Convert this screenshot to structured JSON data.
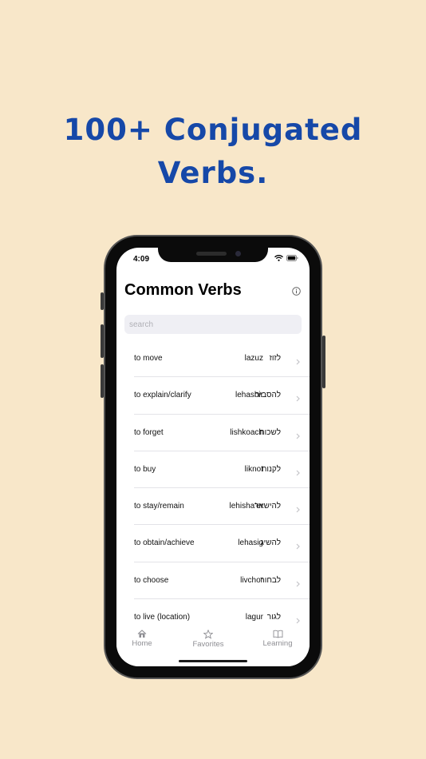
{
  "headline": {
    "line1": "100+ Conjugated",
    "line2": "Verbs."
  },
  "status": {
    "time": "4:09"
  },
  "nav": {
    "title": "Common Verbs"
  },
  "search": {
    "placeholder": "search"
  },
  "verbs": [
    {
      "english": "to move",
      "transliteration": "lazuz",
      "hebrew": "לזוז"
    },
    {
      "english": "to explain/clarify",
      "transliteration": "lehasbir",
      "hebrew": "להסביר"
    },
    {
      "english": "to forget",
      "transliteration": "lishkoach",
      "hebrew": "לשכוח"
    },
    {
      "english": "to buy",
      "transliteration": "liknot",
      "hebrew": "לקנות"
    },
    {
      "english": "to stay/remain",
      "transliteration": "lehisha'er",
      "hebrew": "להישאר"
    },
    {
      "english": "to obtain/achieve",
      "transliteration": "lehasig",
      "hebrew": "להשיג"
    },
    {
      "english": "to choose",
      "transliteration": "livchor",
      "hebrew": "לבחור"
    },
    {
      "english": "to live (location)",
      "transliteration": "lagur",
      "hebrew": "לגור"
    }
  ],
  "tabs": [
    {
      "label": "Home",
      "icon": "house-icon"
    },
    {
      "label": "Favorites",
      "icon": "star-icon"
    },
    {
      "label": "Learning",
      "icon": "book-icon"
    }
  ],
  "colors": {
    "background": "#f8e7c9",
    "headline": "#1648a8"
  }
}
